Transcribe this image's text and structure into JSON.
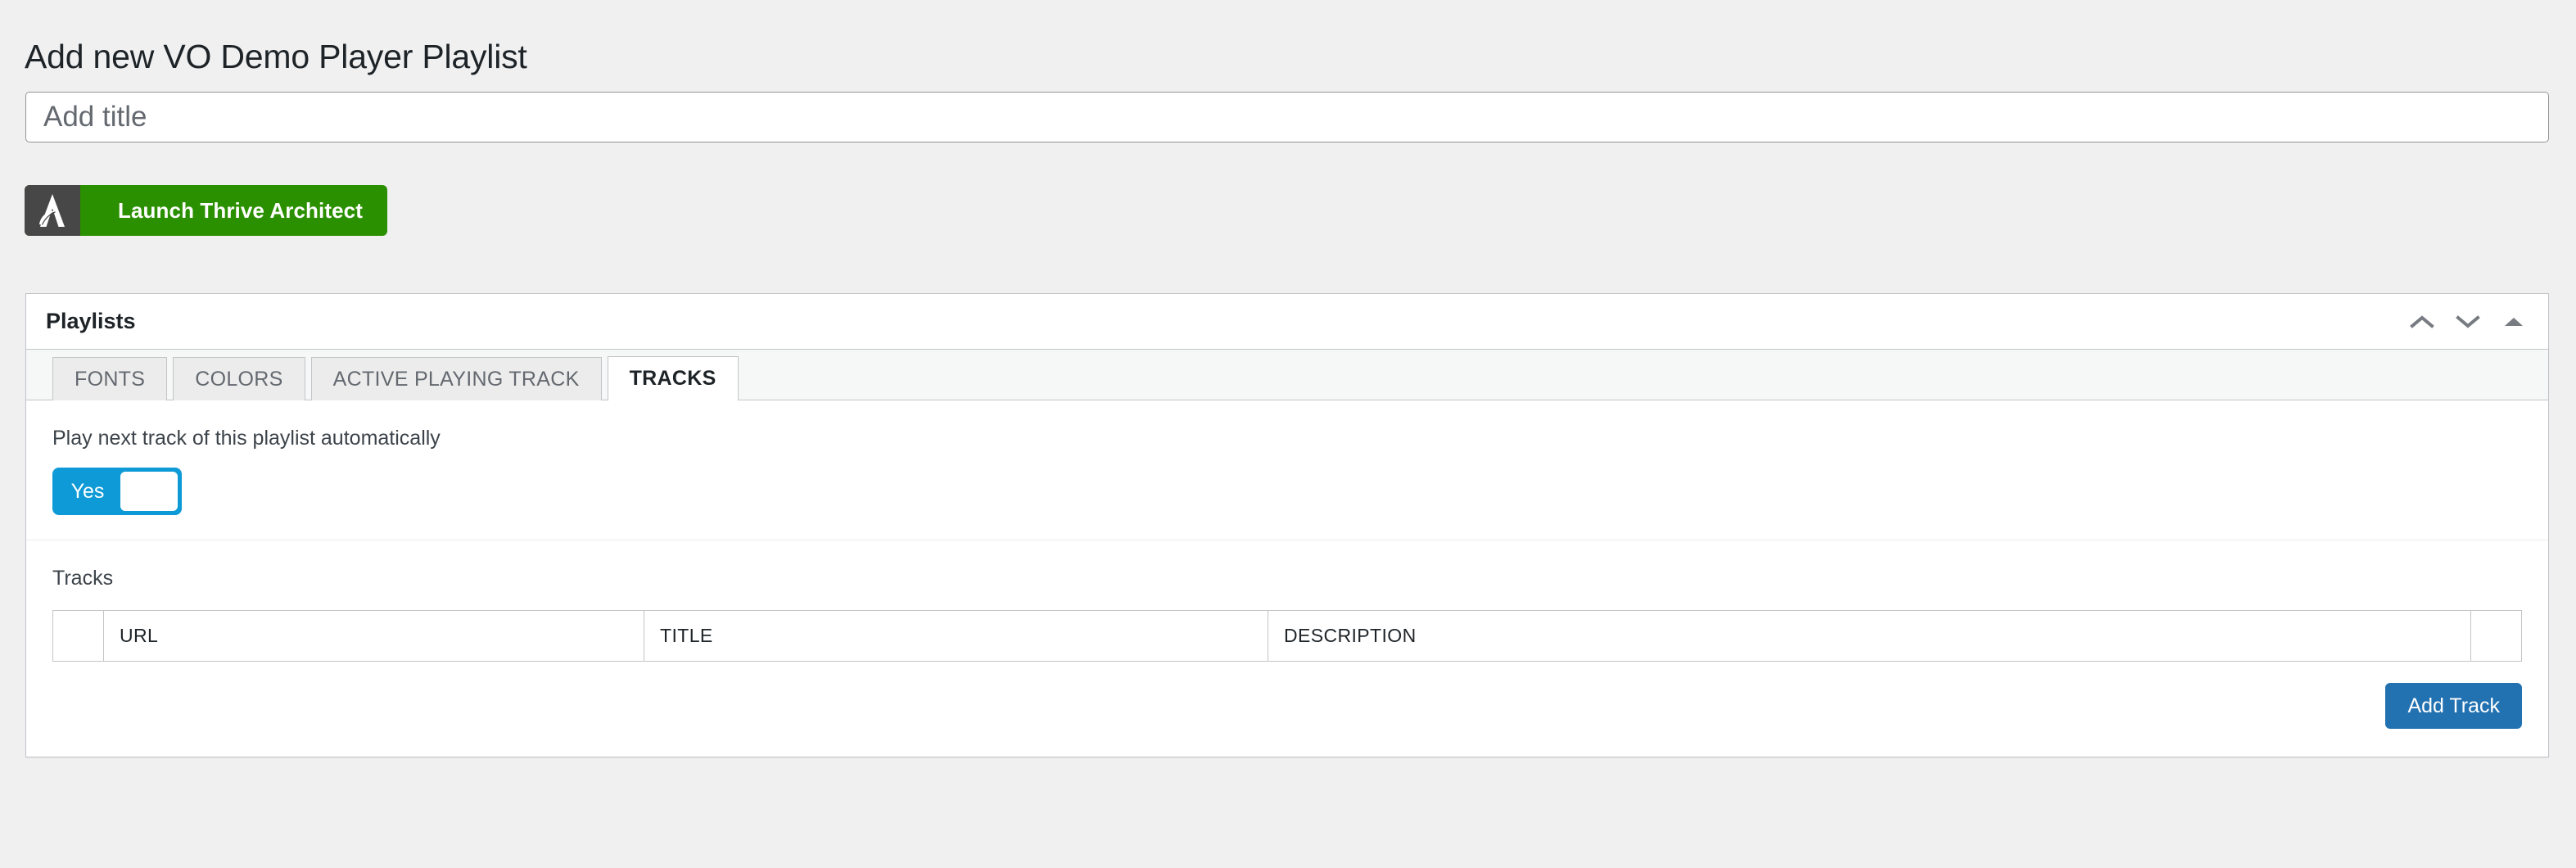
{
  "page": {
    "title": "Add new VO Demo Player Playlist"
  },
  "title_field": {
    "name": "post-title-input",
    "value": "",
    "placeholder": "Add title"
  },
  "thrive_button": {
    "label": "Launch Thrive Architect",
    "logo_icon": "thrive-architect-logo-icon",
    "logo_bg": "#474747",
    "accent": "#2b9000"
  },
  "metabox": {
    "title": "Playlists",
    "handle_actions": [
      {
        "icon": "chevron-up-icon",
        "name": "move-up-button"
      },
      {
        "icon": "chevron-down-icon",
        "name": "move-down-button"
      },
      {
        "icon": "triangle-up-icon",
        "name": "toggle-panel-button"
      }
    ],
    "tabs": [
      {
        "label": "FONTS",
        "active": false
      },
      {
        "label": "COLORS",
        "active": false
      },
      {
        "label": "ACTIVE PLAYING TRACK",
        "active": false
      },
      {
        "label": "TRACKS",
        "active": true
      }
    ],
    "autoplay": {
      "label": "Play next track of this playlist automatically",
      "toggle_value": "Yes",
      "toggle_on": true,
      "toggle_color": "#0d9ad6"
    },
    "tracks": {
      "heading": "Tracks",
      "columns": [
        {
          "label": "",
          "key": "handle"
        },
        {
          "label": "URL",
          "key": "url"
        },
        {
          "label": "TITLE",
          "key": "title"
        },
        {
          "label": "DESCRIPTION",
          "key": "description"
        },
        {
          "label": "",
          "key": "actions"
        }
      ],
      "rows": [],
      "add_button_label": "Add Track",
      "add_button_color": "#2271b1"
    }
  }
}
